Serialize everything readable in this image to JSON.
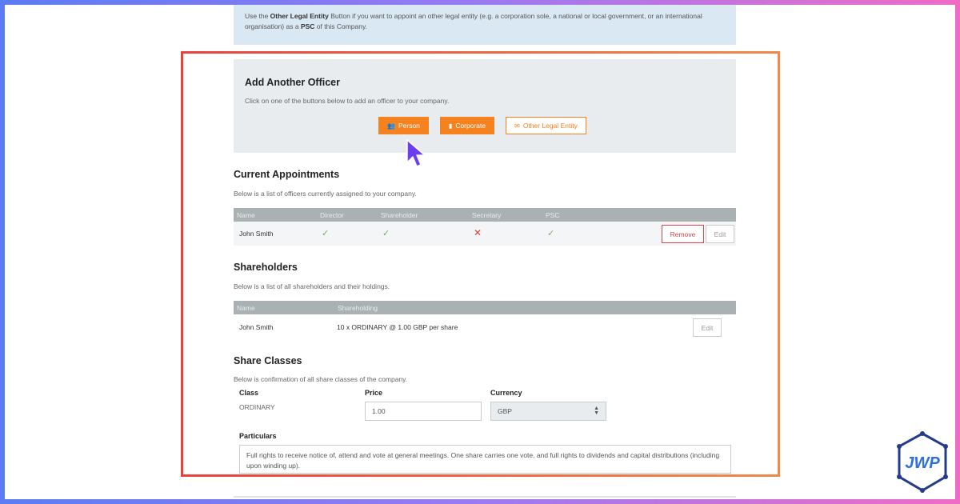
{
  "info": {
    "prefix": "Use the ",
    "bold1": "Other Legal Entity",
    "middle": " Button if you want to appoint an other legal entity (e.g. a corporation sole, a national or local government, or an international organisation) as a ",
    "bold2": "PSC",
    "suffix": " of this Company."
  },
  "add_officer": {
    "title": "Add Another Officer",
    "description": "Click on one of the buttons below to add an officer to your company.",
    "buttons": {
      "person": "Person",
      "corporate": "Corporate",
      "other": "Other Legal Entity"
    }
  },
  "appointments": {
    "title": "Current Appointments",
    "description": "Below is a list of officers currently assigned to your company.",
    "columns": [
      "Name",
      "Director",
      "Shareholder",
      "Secretary",
      "PSC"
    ],
    "rows": [
      {
        "name": "John Smith",
        "director": "✓",
        "shareholder": "✓",
        "secretary": "✕",
        "psc": "✓",
        "remove_label": "Remove",
        "edit_label": "Edit"
      }
    ]
  },
  "shareholders": {
    "title": "Shareholders",
    "description": "Below is a list of all shareholders and their holdings.",
    "columns": [
      "Name",
      "Shareholding"
    ],
    "rows": [
      {
        "name": "John Smith",
        "holding": "10 x ORDINARY @ 1.00 GBP per share",
        "edit_label": "Edit"
      }
    ]
  },
  "share_classes": {
    "title": "Share Classes",
    "description": "Below is confirmation of all share classes of the company.",
    "class_label": "Class",
    "class_value": "ORDINARY",
    "price_label": "Price",
    "price_value": "1.00",
    "currency_label": "Currency",
    "currency_value": "GBP",
    "particulars_label": "Particulars",
    "particulars_value": "Full rights to receive notice of, attend and vote at general meetings. One share carries one vote, and full rights to dividends and capital distributions (including upon winding up)."
  },
  "logo": {
    "text": "JWP"
  },
  "colors": {
    "accent": "#f5811f",
    "danger": "#d9454a",
    "check": "#7caa6a",
    "cursor": "#6b3ef0"
  }
}
